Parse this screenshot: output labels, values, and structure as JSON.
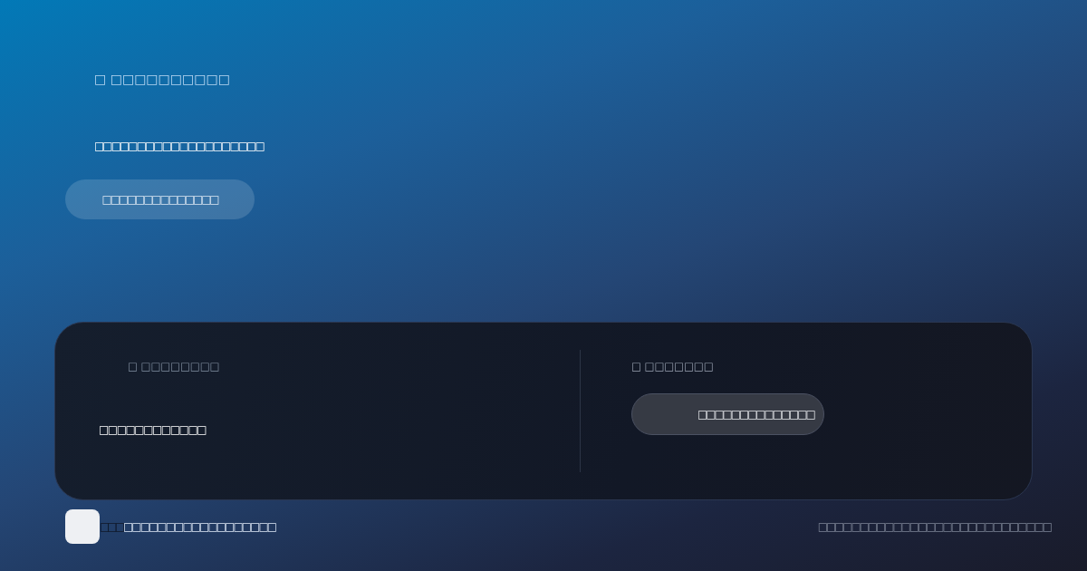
{
  "hero": {
    "title": "□ □□□□□□□□□□",
    "subtitle": "□□□□□□□□□□□□□□□□□□□□",
    "button": "□□□□□□□□□□□□□□"
  },
  "panel": {
    "left": {
      "label": "□ □□□□□□□□",
      "value": "□□□□□□□□□□□□"
    },
    "right": {
      "label": "□ □□□□□□□",
      "button": "□□□□□□□□□□□□□□"
    }
  },
  "footer": {
    "logo_text": "□□□",
    "caption": "□□□□□□□□□□□□□□□□□□",
    "note": "□□□□□□□□□□□□□□□□□□□□□□□□□□□□"
  }
}
